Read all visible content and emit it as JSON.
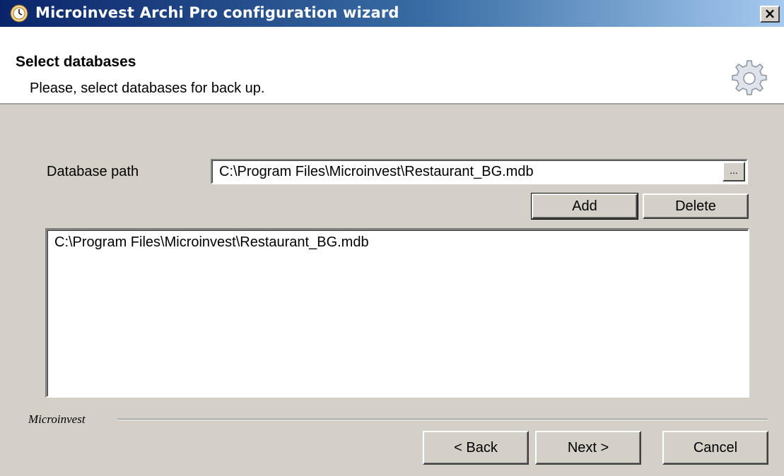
{
  "window": {
    "title": "Microinvest Archi Pro configuration wizard",
    "app_icon": "clock-globe-icon",
    "close_label": "×"
  },
  "header": {
    "title": "Select databases",
    "subtitle": "Please, select databases for back up.",
    "icon": "gear-icon"
  },
  "form": {
    "db_path_label": "Database path",
    "db_path_value": "C:\\Program Files\\Microinvest\\Restaurant_BG.mdb",
    "browse_label": "...",
    "add_label": "Add",
    "delete_label": "Delete"
  },
  "database_list": [
    "C:\\Program Files\\Microinvest\\Restaurant_BG.mdb"
  ],
  "footer": {
    "brand": "Microinvest",
    "back_label": "< Back",
    "next_label": "Next >",
    "cancel_label": "Cancel"
  },
  "colors": {
    "titlebar_start": "#0a246a",
    "titlebar_end": "#a6caf0",
    "dialog_bg": "#d4d0c8"
  }
}
